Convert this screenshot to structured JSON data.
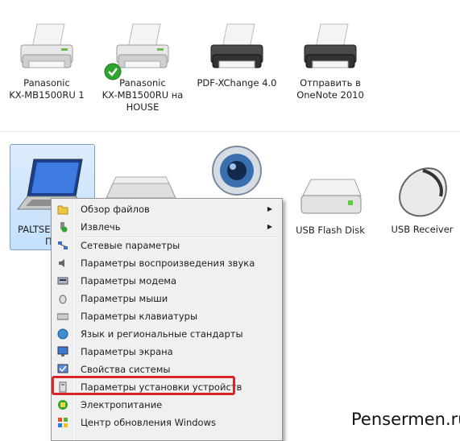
{
  "printers": [
    {
      "line1": "Panasonic",
      "line2": "KX-MB1500RU 1",
      "line3": ""
    },
    {
      "line1": "Panasonic",
      "line2": "KX-MB1500RU на",
      "line3": "HOUSE"
    },
    {
      "line1": "PDF-XChange 4.0",
      "line2": "",
      "line3": ""
    },
    {
      "line1": "Отправить в",
      "line2": "OneNote 2010",
      "line3": ""
    }
  ],
  "devices": {
    "laptop": {
      "line1": "PALTSEV",
      "line2": "П"
    },
    "flash": {
      "label": "USB Flash Disk"
    },
    "receiver": {
      "label": "USB Receiver"
    }
  },
  "menu": {
    "items": [
      {
        "label": "Обзор файлов",
        "icon": "folder-icon",
        "submenu": true
      },
      {
        "label": "Извлечь",
        "icon": "eject-icon",
        "submenu": true
      },
      {
        "label": "Сетевые параметры",
        "icon": "network-icon",
        "submenu": false
      },
      {
        "label": "Параметры воспроизведения звука",
        "icon": "speaker-icon",
        "submenu": false
      },
      {
        "label": "Параметры модема",
        "icon": "modem-icon",
        "submenu": false
      },
      {
        "label": "Параметры мыши",
        "icon": "mouse-icon",
        "submenu": false
      },
      {
        "label": "Параметры клавиатуры",
        "icon": "keyboard-icon",
        "submenu": false
      },
      {
        "label": "Язык и региональные стандарты",
        "icon": "globe-icon",
        "submenu": false
      },
      {
        "label": "Параметры экрана",
        "icon": "display-icon",
        "submenu": false
      },
      {
        "label": "Свойства системы",
        "icon": "system-icon",
        "submenu": false
      },
      {
        "label": "Параметры установки устройств",
        "icon": "device-install-icon",
        "submenu": false
      },
      {
        "label": "Электропитание",
        "icon": "power-icon",
        "submenu": false
      },
      {
        "label": "Центр обновления Windows",
        "icon": "windows-update-icon",
        "submenu": false
      }
    ],
    "arrow": "▶"
  },
  "watermark": "Pensermen.ru",
  "colors": {
    "highlight": "#d9262a",
    "selection": "#c4e0fb",
    "check": "#2ea52e"
  }
}
